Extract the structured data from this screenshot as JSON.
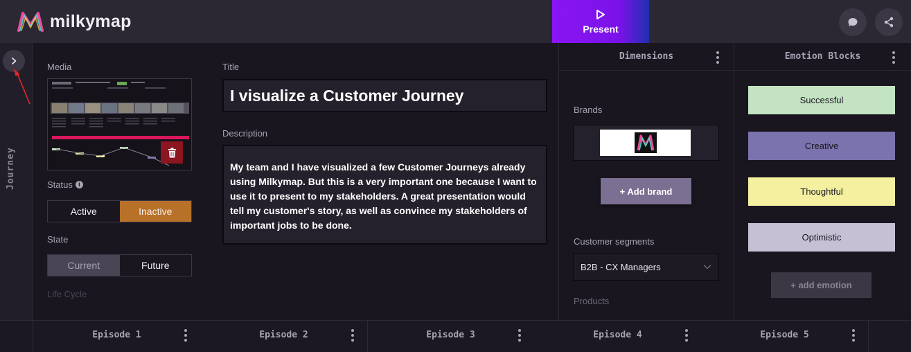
{
  "app": {
    "name": "milkymap"
  },
  "header": {
    "present_label": "Present"
  },
  "sidebar": {
    "tab_label": "Journey"
  },
  "main": {
    "media_label": "Media",
    "status_label": "Status",
    "status_options": [
      "Active",
      "Inactive"
    ],
    "status_selected": "Inactive",
    "state_label": "State",
    "state_options": [
      "Current",
      "Future"
    ],
    "state_selected": "Current",
    "lifecycle_label": "Life Cycle",
    "title_label": "Title",
    "title_value": "I visualize a Customer Journey",
    "description_label": "Description",
    "description_value": "My team and I have visualized a few Customer Journeys already using Milkymap. But this is a very important one because I want to use it to present to my stakeholders. A great presentation would tell my customer's story, as well as convince my stakeholders of important jobs to be done."
  },
  "dimensions": {
    "header": "Dimensions",
    "brands_label": "Brands",
    "add_brand_label": "+ Add brand",
    "customer_segments_label": "Customer segments",
    "customer_segment_value": "B2B - CX Managers",
    "products_label": "Products"
  },
  "emotions": {
    "header": "Emotion Blocks",
    "blocks": [
      {
        "label": "Successful",
        "color": "#c3e3c3"
      },
      {
        "label": "Creative",
        "color": "#7b73ad"
      },
      {
        "label": "Thoughtful",
        "color": "#f4f0a0"
      },
      {
        "label": "Optimistic",
        "color": "#c5c0d3"
      }
    ],
    "add_label": "+ add emotion"
  },
  "episodes": [
    "Episode 1",
    "Episode 2",
    "Episode 3",
    "Episode 4",
    "Episode 5"
  ],
  "icons": [
    "logo-icon",
    "play-icon",
    "comment-icon",
    "share-icon",
    "chevron-right-icon",
    "trash-icon",
    "info-icon",
    "chevron-down-icon",
    "more-vertical-icon"
  ]
}
